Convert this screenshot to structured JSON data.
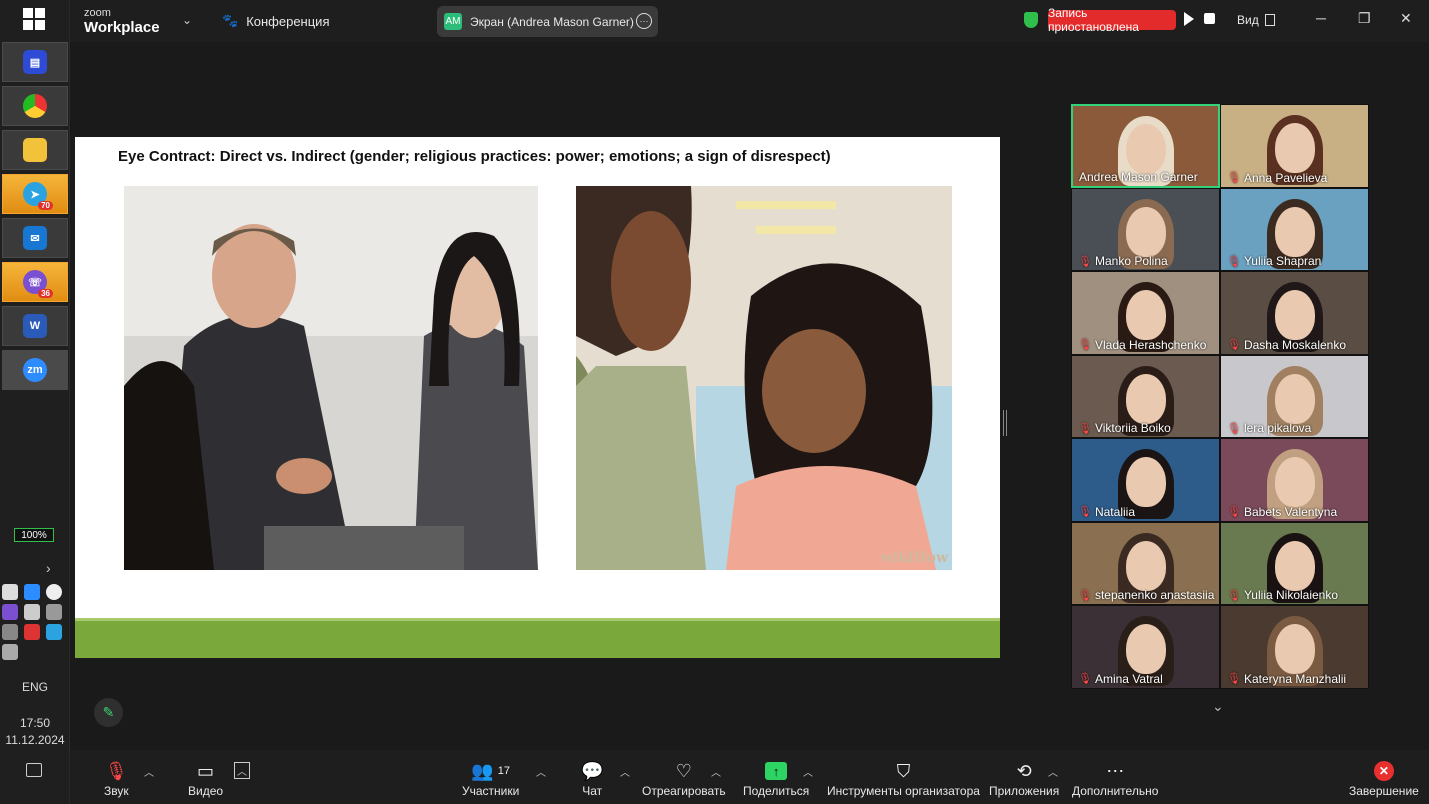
{
  "app": {
    "logo_small": "zoom",
    "logo_big": "Workplace",
    "conference_label": "Конференция",
    "share_badge": "AM",
    "share_label": "Экран (Andrea Mason Garner)",
    "recording_status": "Запись приостановлена",
    "view_label": "Вид"
  },
  "colors": {
    "accent_green": "#2dd363",
    "recording_red": "#e32b2b",
    "slide_bar": "#7aa83a"
  },
  "slide": {
    "title": "Eye Contract: Direct vs. Indirect (gender; religious practices: power; emotions; a sign of disrespect)",
    "watermark": "wikiHow"
  },
  "participants": [
    {
      "name": "Andrea Mason Garner",
      "muted": false,
      "active": true
    },
    {
      "name": "Anna Pavelieva",
      "muted": true
    },
    {
      "name": "Manko Polina",
      "muted": true
    },
    {
      "name": "Yuliia Shapran",
      "muted": true
    },
    {
      "name": "Vlada Herashchenko",
      "muted": true
    },
    {
      "name": "Dasha Moskalenko",
      "muted": true
    },
    {
      "name": "Viktoriia Boiko",
      "muted": true
    },
    {
      "name": "lera pikalova",
      "muted": true
    },
    {
      "name": "Nataliia",
      "muted": true
    },
    {
      "name": "Babets Valentyna",
      "muted": true
    },
    {
      "name": "stepanenko anastasiia",
      "muted": true
    },
    {
      "name": "Yuliia Nikolaienko",
      "muted": true
    },
    {
      "name": "Amina Vatral",
      "muted": true
    },
    {
      "name": "Kateryna Manzhalii",
      "muted": true
    }
  ],
  "toolbar": {
    "audio": "Звук",
    "video": "Видео",
    "participants": "Участники",
    "participants_count": "17",
    "chat": "Чат",
    "react": "Отреагировать",
    "share": "Поделиться",
    "host_tools": "Инструменты организатора",
    "apps": "Приложения",
    "more": "Дополнительно",
    "end": "Завершение"
  },
  "system": {
    "battery": "100%",
    "language": "ENG",
    "time": "17:50",
    "date": "11.12.2024",
    "telegram_badge": "70",
    "viber_badge": "36"
  }
}
